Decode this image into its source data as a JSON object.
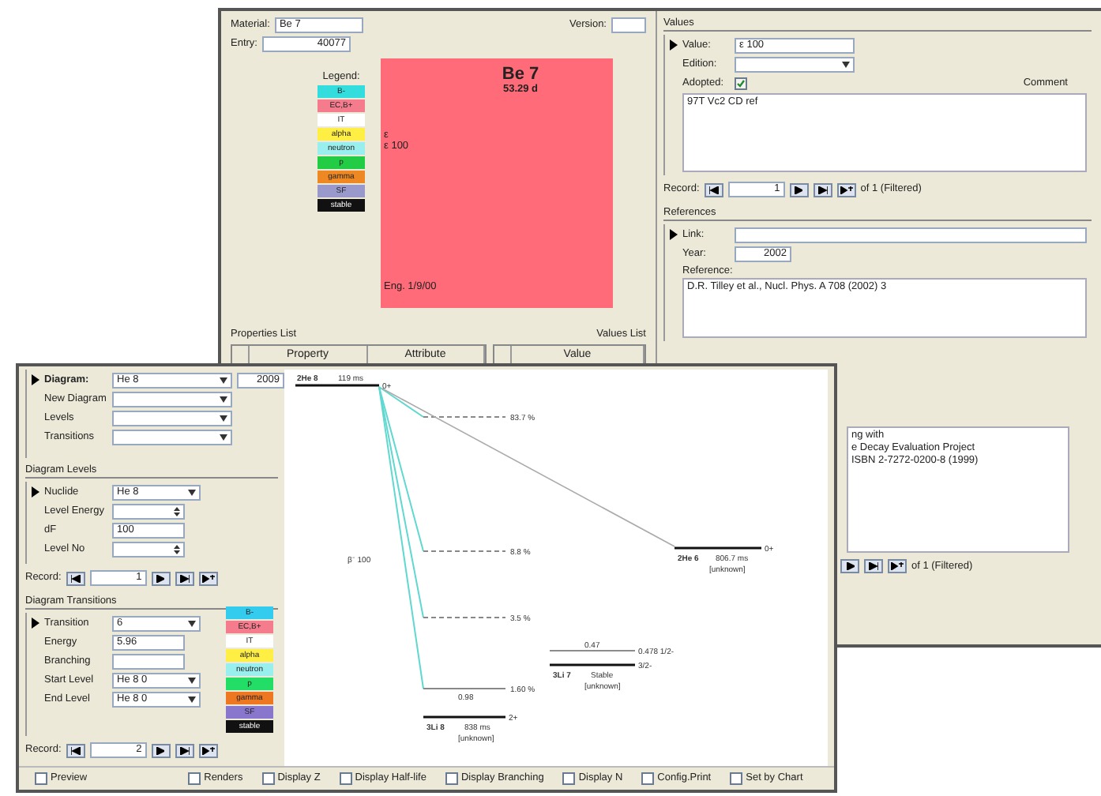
{
  "material_window": {
    "material": {
      "label": "Material:",
      "value": "Be 7"
    },
    "entry": {
      "label": "Entry:",
      "value": "40077"
    },
    "version": {
      "label": "Version:"
    },
    "legend": {
      "title": "Legend:",
      "items": [
        {
          "label": "B-",
          "color": "#33dddd"
        },
        {
          "label": "EC,B+",
          "color": "#f47c8c"
        },
        {
          "label": "IT",
          "color": "#ffffff"
        },
        {
          "label": "alpha",
          "color": "#ffee44"
        },
        {
          "label": "neutron",
          "color": "#99eeee"
        },
        {
          "label": "p",
          "color": "#22cc44"
        },
        {
          "label": "gamma",
          "color": "#ee8822"
        },
        {
          "label": "SF",
          "color": "#9999cc"
        },
        {
          "label": "stable",
          "color": "#111111"
        }
      ]
    },
    "nuclide_card": {
      "name": "Be 7",
      "half_life": "53.29 d",
      "decay_mode": "ε",
      "branching": "ε 100",
      "footer": "Eng. 1/9/00"
    },
    "properties_list": {
      "title": "Properties List",
      "columns": [
        "Property",
        "Attribute"
      ]
    },
    "values_list": {
      "title": "Values List",
      "columns": [
        "Value"
      ]
    },
    "values": {
      "title": "Values",
      "value": {
        "label": "Value:",
        "value": "ε 100"
      },
      "edition": {
        "label": "Edition:"
      },
      "adopted": {
        "label": "Adopted:",
        "checked": true
      },
      "comment": {
        "label": "Comment",
        "text": "97T Vc2 CD ref"
      },
      "record": {
        "label": "Record:",
        "current": "1",
        "total": "of 1 (Filtered)"
      }
    },
    "references": {
      "title": "References",
      "link": {
        "label": "Link:"
      },
      "year": {
        "label": "Year:",
        "value": "2002"
      },
      "reference": {
        "label": "Reference:",
        "text": "D.R. Tilley et al., Nucl. Phys. A 708 (2002) 3"
      },
      "notes_lines": [
        "ng with",
        "e Decay Evaluation Project",
        "ISBN 2-7272-0200-8 (1999)"
      ],
      "record": {
        "total": "of 1 (Filtered)"
      }
    }
  },
  "diagram_window": {
    "diagram": {
      "label": "Diagram:",
      "value": "He 8"
    },
    "year": "2009",
    "menu_fields": [
      {
        "label": "New Diagram"
      },
      {
        "label": "Levels"
      },
      {
        "label": "Transitions"
      }
    ],
    "levels_section": {
      "title": "Diagram Levels",
      "fields": [
        {
          "label": "Nuclide",
          "value": "He 8",
          "kind": "combo"
        },
        {
          "label": "Level Energy",
          "kind": "spin"
        },
        {
          "label": "dF",
          "value": "100",
          "kind": "text"
        },
        {
          "label": "Level No",
          "kind": "spin"
        }
      ],
      "record": {
        "label": "Record:",
        "current": "1"
      }
    },
    "transitions_section": {
      "title": "Diagram Transitions",
      "fields": [
        {
          "label": "Transition",
          "value": "6",
          "kind": "combo"
        },
        {
          "label": "Energy",
          "value": "5.96",
          "kind": "text"
        },
        {
          "label": "Branching",
          "kind": "text"
        },
        {
          "label": "Start Level",
          "value": "He 8 0",
          "kind": "combo"
        },
        {
          "label": "End Level",
          "value": "He 8 0",
          "kind": "combo"
        }
      ],
      "legend": [
        {
          "label": "B-",
          "color": "#33ccee"
        },
        {
          "label": "EC,B+",
          "color": "#f47c8c"
        },
        {
          "label": "IT",
          "color": "#ffffff"
        },
        {
          "label": "alpha",
          "color": "#ffee44"
        },
        {
          "label": "neutron",
          "color": "#99eeee"
        },
        {
          "label": "p",
          "color": "#22dd66"
        },
        {
          "label": "gamma",
          "color": "#ee7722"
        },
        {
          "label": "SF",
          "color": "#8877cc"
        },
        {
          "label": "stable",
          "color": "#111111"
        }
      ],
      "record": {
        "label": "Record:",
        "current": "2"
      }
    },
    "level_scheme": {
      "beta_label": "β⁻ 100",
      "levels": [
        {
          "kind": "parent",
          "name": "2He 8",
          "half_life": "119 ms",
          "spin": "0+"
        },
        {
          "kind": "dashed",
          "label": "83.7 %"
        },
        {
          "kind": "dashed",
          "label": "8.8 %"
        },
        {
          "kind": "dashed",
          "label": "3.5 %"
        },
        {
          "kind": "solid",
          "label": "1.60 %"
        },
        {
          "kind": "daughter",
          "name": "3Li 8",
          "half_life": "838 ms",
          "note": "[unknown]",
          "spin": "2+",
          "mark": "0.98"
        },
        {
          "kind": "daughter",
          "name": "3Li 7",
          "half_life": "Stable",
          "note": "[unknown]",
          "spin": "3/2-",
          "mark": "0.47",
          "upper": "0.478 1/2-"
        },
        {
          "kind": "daughter",
          "name": "2He 6",
          "half_life": "806.7 ms",
          "note": "[unknown]",
          "spin": "0+"
        }
      ]
    },
    "options": [
      {
        "label": "Preview",
        "checked": false
      },
      {
        "label": "Renders",
        "checked": false
      },
      {
        "label": "Display Z",
        "checked": false
      },
      {
        "label": "Display Half-life",
        "checked": false
      },
      {
        "label": "Display Branching",
        "checked": false
      },
      {
        "label": "Display N",
        "checked": false
      },
      {
        "label": "Config.Print",
        "checked": false
      },
      {
        "label": "Set by Chart",
        "checked": false
      }
    ]
  }
}
